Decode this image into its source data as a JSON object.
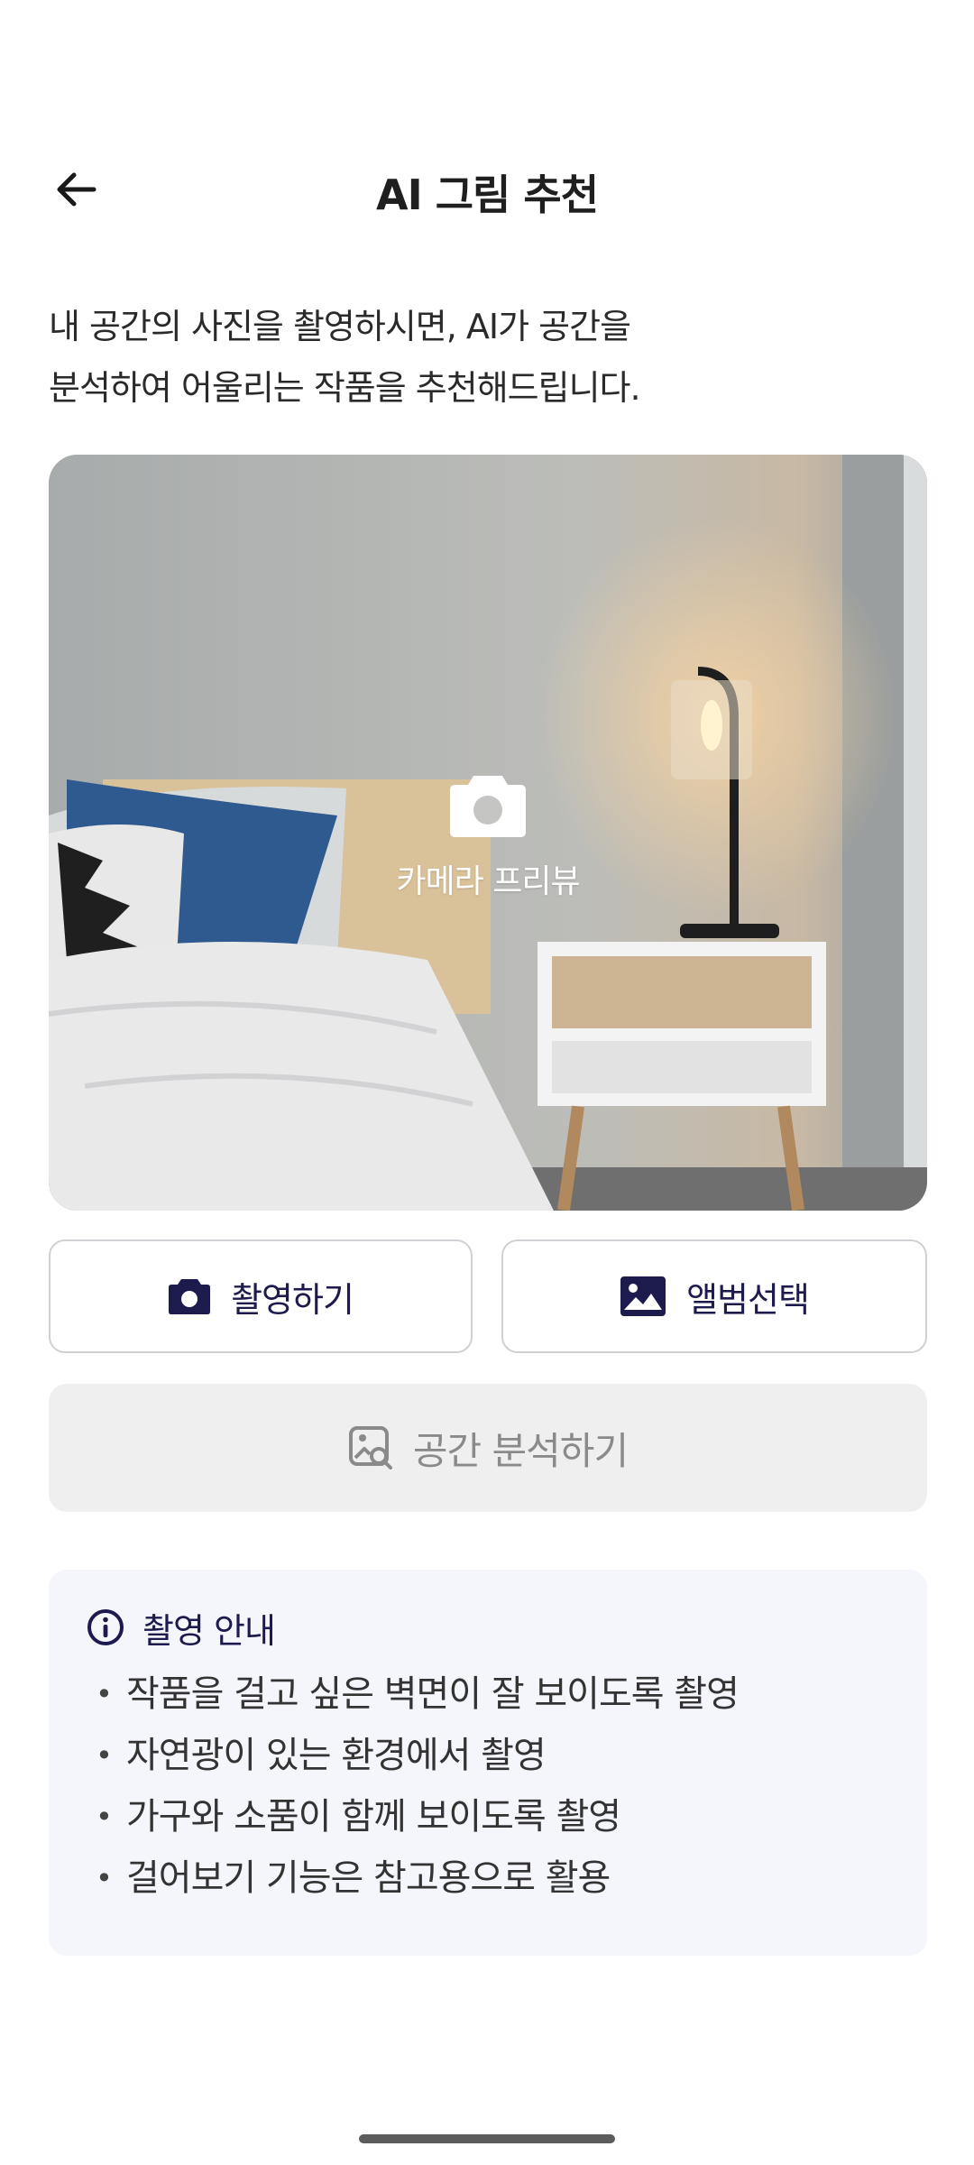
{
  "header": {
    "title": "AI 그림 추천",
    "back_icon": "arrow-left-icon"
  },
  "intro": {
    "line1": "내 공간의 사진을 촬영하시면, AI가 공간을",
    "line2": "분석하여 어울리는 작품을 추천해드립니다."
  },
  "preview": {
    "label": "카메라 프리뷰",
    "icon": "camera-icon"
  },
  "buttons": {
    "capture_label": "촬영하기",
    "capture_icon": "camera-icon",
    "album_label": "앨범선택",
    "album_icon": "image-icon",
    "analyze_label": "공간 분석하기",
    "analyze_icon": "image-search-icon"
  },
  "guide": {
    "title": "촬영 안내",
    "icon": "info-icon",
    "items": [
      "작품을 걸고 싶은 벽면이 잘 보이도록 촬영",
      "자연광이 있는 환경에서 촬영",
      "가구와 소품이 함께 보이도록 촬영",
      "걸어보기 기능은 참고용으로 활용"
    ]
  },
  "colors": {
    "accent": "#1d1b4d",
    "disabled_bg": "#efefef",
    "disabled_text": "#8a8a8a",
    "guide_bg": "#f5f6fc"
  }
}
